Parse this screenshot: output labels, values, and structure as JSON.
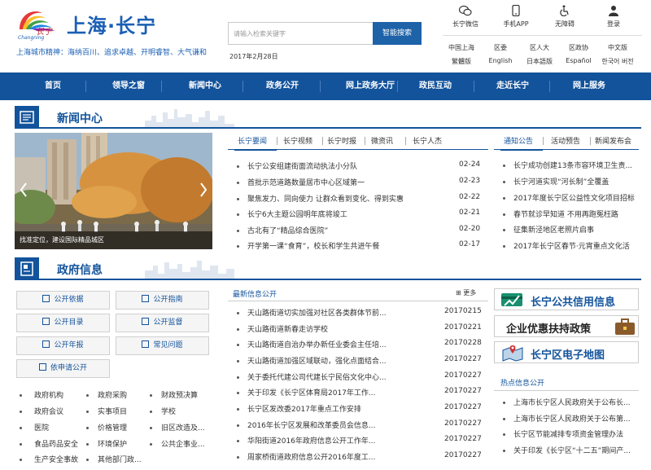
{
  "header": {
    "site_title": "上海·长宁",
    "logo_script": "长宁",
    "logo_sub": "Changning",
    "spirit": "上海城市精神：海纳百川、追求卓越、开明睿智、大气谦和",
    "search_placeholder": "请输入检索关键字",
    "search_button": "智能搜索",
    "date": "2017年2月28日",
    "quick_links": [
      {
        "label": "长宁微信",
        "icon": "wechat-icon"
      },
      {
        "label": "手机APP",
        "icon": "phone-icon"
      },
      {
        "label": "无障碍",
        "icon": "accessibility-icon"
      },
      {
        "label": "登录",
        "icon": "user-icon"
      }
    ],
    "lang_row1": [
      "中国上海",
      "区委",
      "区人大",
      "区政协",
      "中文版"
    ],
    "lang_row2": [
      "繁體版",
      "English",
      "日本語版",
      "Español",
      "한국어 버전"
    ]
  },
  "nav": [
    "首页",
    "领导之窗",
    "新闻中心",
    "政务公开",
    "网上政务大厅",
    "政民互动",
    "走近长宁",
    "网上服务"
  ],
  "news_center": {
    "title": "新闻中心",
    "photo_caption": "找准定位，建设国际精品城区",
    "tabs": [
      "长宁要闻",
      "长宁视频",
      "长宁时报",
      "微资讯",
      "长宁人杰"
    ],
    "items": [
      {
        "title": "长宁公安组建街面流动执法小分队",
        "date": "02-24"
      },
      {
        "title": "首批示范道路数量居市中心区域第一",
        "date": "02-23"
      },
      {
        "title": "聚焦发力、同向使力 让群众看到变化、得到实惠",
        "date": "02-22"
      },
      {
        "title": "长宁6大主题公园明年底将竣工",
        "date": "02-21"
      },
      {
        "title": "古北有了“精品综合医院”",
        "date": "02-20"
      },
      {
        "title": "开学第一课“食育”，校长和学生共进午餐",
        "date": "02-17"
      }
    ],
    "right_tabs": [
      "通知公告",
      "活动预告",
      "新闻发布会"
    ],
    "right_items": [
      "长宁成功创建13条市容环境卫生责...",
      "长宁河道实现“河长制”全覆盖",
      "2017年度长宁区公益性文化项目招标",
      "春节就诊早知道 不用再跑冤枉路",
      "征集新泾地区老照片启事",
      "2017年长宁区春节·元宵重点文化活"
    ]
  },
  "gov_info": {
    "title": "政府信息",
    "buttons": [
      {
        "label": "公开依据",
        "icon": "document-icon"
      },
      {
        "label": "公开指南",
        "icon": "signpost-icon"
      },
      {
        "label": "公开目录",
        "icon": "list-icon"
      },
      {
        "label": "公开监督",
        "icon": "eye-icon"
      },
      {
        "label": "公开年报",
        "icon": "report-icon"
      },
      {
        "label": "常见问题",
        "icon": "question-icon"
      },
      {
        "label": "依申请公开",
        "icon": "apply-icon"
      }
    ],
    "links": [
      [
        "政府机构",
        "政府采购",
        "财政预决算"
      ],
      [
        "政府会议",
        "实事项目",
        "学校"
      ],
      [
        "医院",
        "价格管理",
        "旧区改造及..."
      ],
      [
        "食品药品安全",
        "环境保护",
        "公共企事业..."
      ],
      [
        "生产安全事故",
        "其他部门政..."
      ]
    ],
    "latest_head": "最新信息公开",
    "more": "更多",
    "latest": [
      {
        "title": "天山路街道切实加强对社区各类群体节前...",
        "date": "20170215"
      },
      {
        "title": "天山路街道新春走访学校",
        "date": "20170221"
      },
      {
        "title": "天山路街道自治办举办新任业委会主任培...",
        "date": "20170228"
      },
      {
        "title": "天山路街道加强区域联动，强化点面结合...",
        "date": "20170227"
      },
      {
        "title": "关于委托代建公司代建长宁民俗文化中心...",
        "date": "20170227"
      },
      {
        "title": "关于印发《长宁区体育局2017年工作...",
        "date": "20170227"
      },
      {
        "title": "长宁区发改委2017年重点工作安排",
        "date": "20170227"
      },
      {
        "title": "2016年长宁区发展和改革委员会信息...",
        "date": "20170227"
      },
      {
        "title": "华阳街道2016年政府信息公开工作年...",
        "date": "20170227"
      },
      {
        "title": "周家桥街道政府信息公开2016年度工...",
        "date": "20170227"
      }
    ],
    "banners": [
      "长宁公共信用信息",
      "企业优惠扶持政策",
      "长宁区电子地图"
    ],
    "hot_head": "热点信息公开",
    "hot": [
      "上海市长宁区人民政府关于公布长...",
      "上海市长宁区人民政府关于公布第...",
      "长宁区节能减排专项资金管理办法",
      "关于印发《长宁区“十二五”期间产..."
    ]
  }
}
